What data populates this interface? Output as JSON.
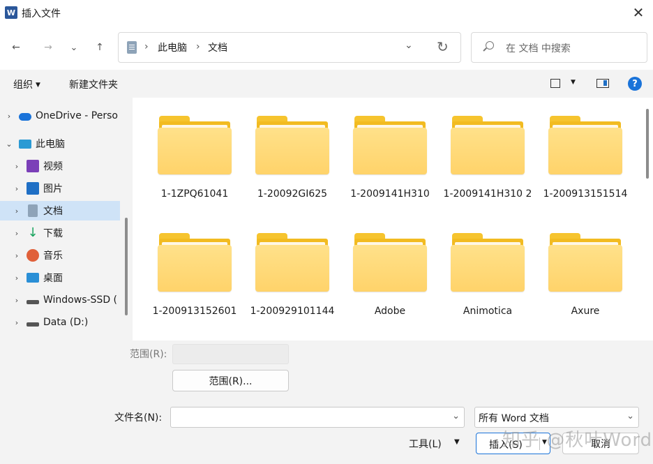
{
  "window": {
    "title": "插入文件",
    "app_icon": "W",
    "close_glyph": "✕"
  },
  "nav": {
    "back_glyph": "←",
    "forward_glyph": "→",
    "recent_glyph": "⌄",
    "up_glyph": "↑",
    "breadcrumbs": [
      "此电脑",
      "文档"
    ],
    "crumb_sep": "›",
    "dropdown_glyph": "⌄",
    "refresh_glyph": "↻",
    "search_placeholder": "在 文档 中搜索"
  },
  "toolbar": {
    "organize": "组织",
    "new_folder": "新建文件夹",
    "caret": "▼",
    "help": "?"
  },
  "sidebar": {
    "items": [
      {
        "label": "OneDrive - Perso",
        "icon": "onedrive-icon",
        "expanded": false,
        "indent": 0,
        "color": "#1a73d9"
      },
      {
        "label": "此电脑",
        "icon": "computer-icon",
        "expanded": true,
        "indent": 0,
        "color": "#2b9ad4"
      },
      {
        "label": "视频",
        "icon": "videos-icon",
        "expanded": false,
        "indent": 1,
        "color": "#7b3fb8"
      },
      {
        "label": "图片",
        "icon": "pictures-icon",
        "expanded": false,
        "indent": 1,
        "color": "#1f6fc5"
      },
      {
        "label": "文档",
        "icon": "documents-icon",
        "expanded": false,
        "indent": 1,
        "color": "#8ea3b8",
        "selected": true
      },
      {
        "label": "下载",
        "icon": "downloads-icon",
        "expanded": false,
        "indent": 1,
        "color": "#17a35c"
      },
      {
        "label": "音乐",
        "icon": "music-icon",
        "expanded": false,
        "indent": 1,
        "color": "#e0603a"
      },
      {
        "label": "桌面",
        "icon": "desktop-icon",
        "expanded": false,
        "indent": 1,
        "color": "#2a8fd6"
      },
      {
        "label": "Windows-SSD (",
        "icon": "windows-drive-icon",
        "expanded": false,
        "indent": 1,
        "color": "#555555"
      },
      {
        "label": "Data (D:)",
        "icon": "drive-icon",
        "expanded": false,
        "indent": 1,
        "color": "#555555"
      }
    ]
  },
  "folders": [
    {
      "name": "1-1ZPQ61041"
    },
    {
      "name": "1-20092GI625"
    },
    {
      "name": "1-2009141H310"
    },
    {
      "name": "1-2009141H310 2"
    },
    {
      "name": "1-200913151514"
    },
    {
      "name": "1-200913152601"
    },
    {
      "name": "1-200929101144"
    },
    {
      "name": "Adobe"
    },
    {
      "name": "Animotica"
    },
    {
      "name": "Axure"
    }
  ],
  "range": {
    "label": "范围(R):",
    "button": "范围(R)..."
  },
  "footer": {
    "filename_label": "文件名(N):",
    "filename_value": "",
    "filetype": "所有 Word 文档",
    "tools": "工具(L)",
    "insert": "插入(S)",
    "cancel": "取消",
    "watermark": "知乎 @秋叶Word"
  },
  "colors": {
    "accent": "#1a73d9",
    "folder": "#ffd36a",
    "selected_bg": "#cfe3f7"
  }
}
